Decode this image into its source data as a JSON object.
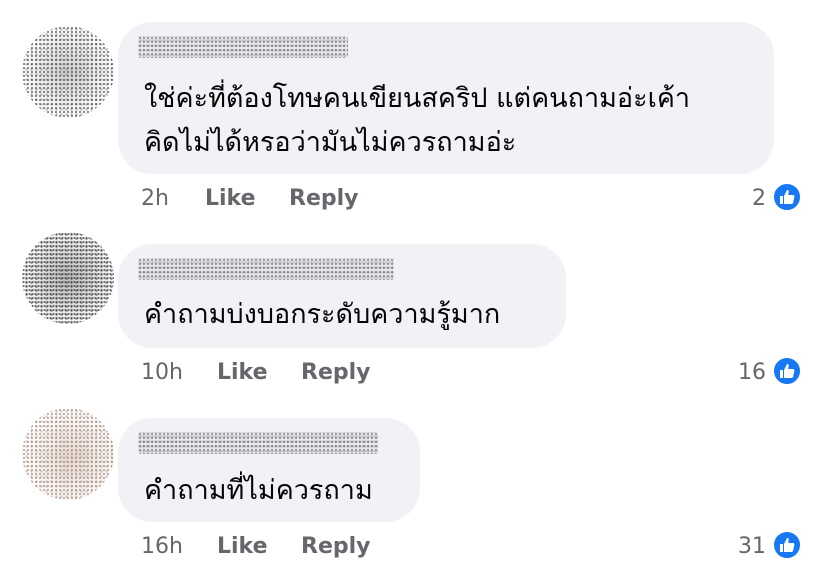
{
  "comments": [
    {
      "lines": [
        "ใช่ค่ะที่ต้องโทษคนเขียนสคริป แต่คนถามอ่ะเค้า",
        "คิดไม่ได้หรอว่ามันไม่ควรถามอ่ะ"
      ],
      "time": "2h",
      "like_label": "Like",
      "reply_label": "Reply",
      "reaction_count": "2"
    },
    {
      "lines": [
        "คำถามบ่งบอกระดับความรู้มาก"
      ],
      "time": "10h",
      "like_label": "Like",
      "reply_label": "Reply",
      "reaction_count": "16"
    },
    {
      "lines": [
        "คำถามที่ไม่ควรถาม"
      ],
      "time": "16h",
      "like_label": "Like",
      "reply_label": "Reply",
      "reaction_count": "31"
    }
  ],
  "colors": {
    "bubble": "#f0f2f5",
    "meta_text": "#65676b",
    "like_blue": "#1877f2"
  },
  "icons": {
    "reaction": "thumbs-up-icon"
  }
}
